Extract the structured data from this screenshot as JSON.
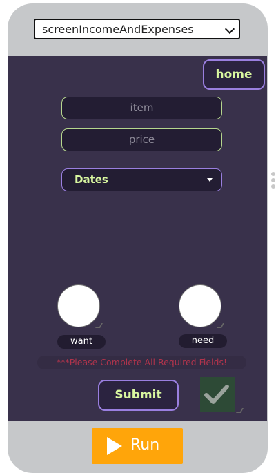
{
  "screen_selector": {
    "selected": "screenIncomeAndExpenses"
  },
  "app": {
    "home_label": "home",
    "item_placeholder": "item",
    "price_placeholder": "price",
    "dates_label": "Dates",
    "want_label": "want",
    "need_label": "need",
    "error_message": "***Please Complete All Required Fields!",
    "submit_label": "Submit"
  },
  "run_label": "Run",
  "icons": {
    "dropdown": "chevron-down-icon",
    "dates_dropdown": "caret-down-icon",
    "checkbox": "checkmark-icon",
    "run": "play-icon",
    "side_handle": "drag-handle-icon"
  },
  "colors": {
    "app_background": "#39314b",
    "accent_text": "#d9f7a0",
    "button_border": "#9a7fe0",
    "error_text": "#b0344c",
    "run_button": "#ffa50a",
    "checkbox_background": "#2d4a36"
  }
}
